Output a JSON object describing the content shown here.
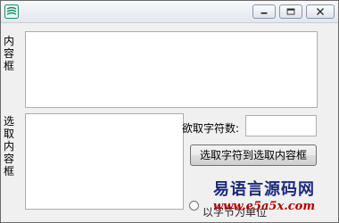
{
  "window": {
    "icon": "app-icon",
    "controls": {
      "minimize": "minimize-icon",
      "maximize": "maximize-icon",
      "close": "close-icon"
    }
  },
  "labels": {
    "content_box": "内容框",
    "selected_box": "选取内容框",
    "count_label": "欲取字符数:"
  },
  "inputs": {
    "content_value": "",
    "selected_value": "",
    "count_value": ""
  },
  "button": {
    "label": "选取字符到选取内容框"
  },
  "radio": {
    "label": "以字节为单位",
    "selected": false
  },
  "watermark": {
    "chinese": "易语言源码网",
    "url": "www.e5a5x.com"
  }
}
